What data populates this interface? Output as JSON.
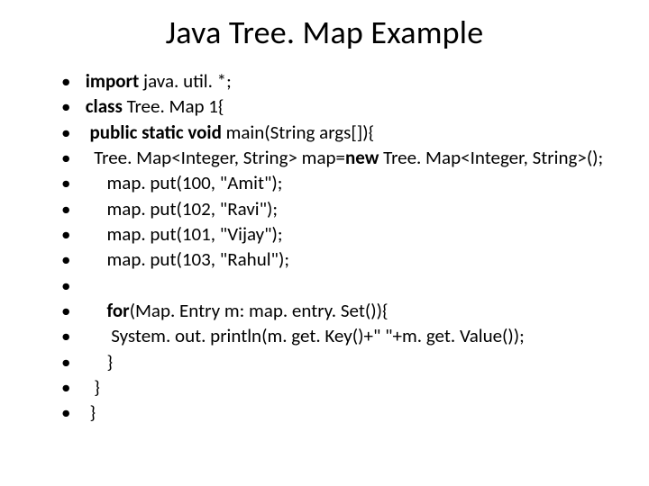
{
  "title": "Java Tree. Map Example",
  "lines": [
    {
      "segments": [
        {
          "t": " ",
          "b": false
        },
        {
          "t": "import",
          "b": true
        },
        {
          "t": " java. util. *;",
          "b": false
        }
      ]
    },
    {
      "segments": [
        {
          "t": " ",
          "b": false
        },
        {
          "t": "class",
          "b": true
        },
        {
          "t": " Tree. Map 1{",
          "b": false
        }
      ]
    },
    {
      "segments": [
        {
          "t": "  ",
          "b": false
        },
        {
          "t": "public static void",
          "b": true
        },
        {
          "t": " main(String args[]){",
          "b": false
        }
      ]
    },
    {
      "segments": [
        {
          "t": "   Tree. Map<Integer, String> map=",
          "b": false
        },
        {
          "t": "new",
          "b": true
        },
        {
          "t": " Tree. Map<Integer, String>();",
          "b": false
        }
      ]
    },
    {
      "segments": [
        {
          "t": "      map. put(100, \"Amit\");",
          "b": false
        }
      ]
    },
    {
      "segments": [
        {
          "t": "      map. put(102, \"Ravi\");",
          "b": false
        }
      ]
    },
    {
      "segments": [
        {
          "t": "      map. put(101, \"Vijay\");",
          "b": false
        }
      ]
    },
    {
      "segments": [
        {
          "t": "      map. put(103, \"Rahul\");",
          "b": false
        }
      ]
    },
    {
      "segments": [
        {
          "t": " ",
          "b": false
        }
      ]
    },
    {
      "segments": [
        {
          "t": "      ",
          "b": false
        },
        {
          "t": "for",
          "b": true
        },
        {
          "t": "(Map. Entry m: map. entry. Set()){",
          "b": false
        }
      ]
    },
    {
      "segments": [
        {
          "t": "       System. out. println(m. get. Key()+\" \"+m. get. Value());",
          "b": false
        }
      ]
    },
    {
      "segments": [
        {
          "t": "      }",
          "b": false
        }
      ]
    },
    {
      "segments": [
        {
          "t": "   }",
          "b": false
        }
      ]
    },
    {
      "segments": [
        {
          "t": "  }",
          "b": false
        }
      ]
    }
  ]
}
